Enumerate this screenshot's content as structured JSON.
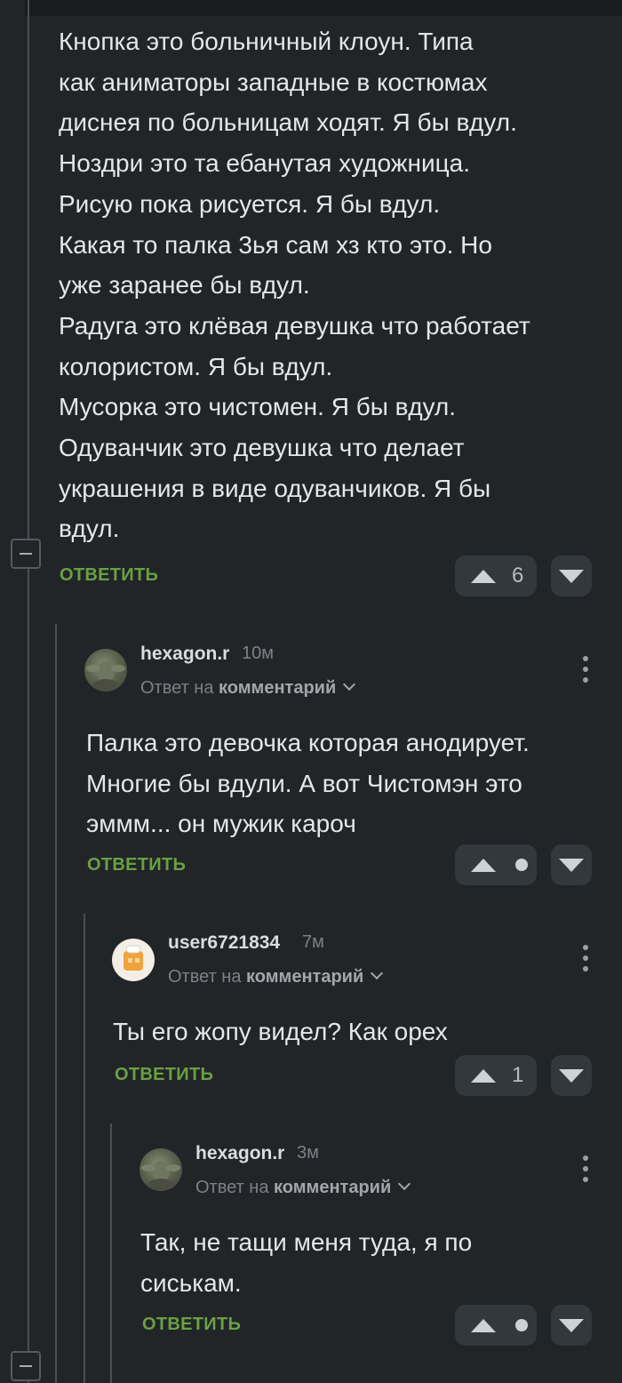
{
  "root_comment": {
    "lines": [
      "Кнопка это больничный клоун. Типа",
      "как аниматоры западные в костюмах",
      "диснея по больницам ходят. Я бы вдул.",
      "Ноздри это та ебанутая художница.",
      "Рисую пока рисуется. Я бы вдул.",
      "Какая то палка 3ья сам хз кто это. Но",
      "уже заранее бы вдул.",
      "Радуга это клёвая девушка что работает",
      "колористом. Я бы вдул.",
      "Мусорка это чистомен. Я бы вдул.",
      "Одуванчик это девушка что делает",
      "украшения в виде одуванчиков. Я бы",
      "вдул."
    ],
    "reply_label": "ОТВЕТИТЬ",
    "rating": "6"
  },
  "replies": [
    {
      "username": "hexagon.r",
      "time": "10м",
      "reply_prefix": "Ответ на",
      "reply_target": "комментарий",
      "lines": [
        "Палка это девочка которая анодирует.",
        "Многие бы вдули. А вот Чистомэн это",
        "эммм... он мужик кароч"
      ],
      "reply_label": "ОТВЕТИТЬ",
      "rating": ""
    },
    {
      "username": "user6721834",
      "time": "7м",
      "reply_prefix": "Ответ на",
      "reply_target": "комментарий",
      "lines": [
        "Ты его жопу видел? Как орех"
      ],
      "reply_label": "ОТВЕТИТЬ",
      "rating": "1"
    },
    {
      "username": "hexagon.r",
      "time": "3м",
      "reply_prefix": "Ответ на",
      "reply_target": "комментарий",
      "lines": [
        "Так, не тащи меня туда, я по",
        "сиськам."
      ],
      "reply_label": "ОТВЕТИТЬ",
      "rating": ""
    }
  ],
  "icons": {
    "collapse": "minus-square-icon",
    "upvote": "triangle-up-icon",
    "downvote": "triangle-down-icon",
    "more": "vertical-dots-icon"
  },
  "colors": {
    "background": "#212528",
    "reply_link": "#6aa043",
    "vote_button": "#33383d"
  }
}
